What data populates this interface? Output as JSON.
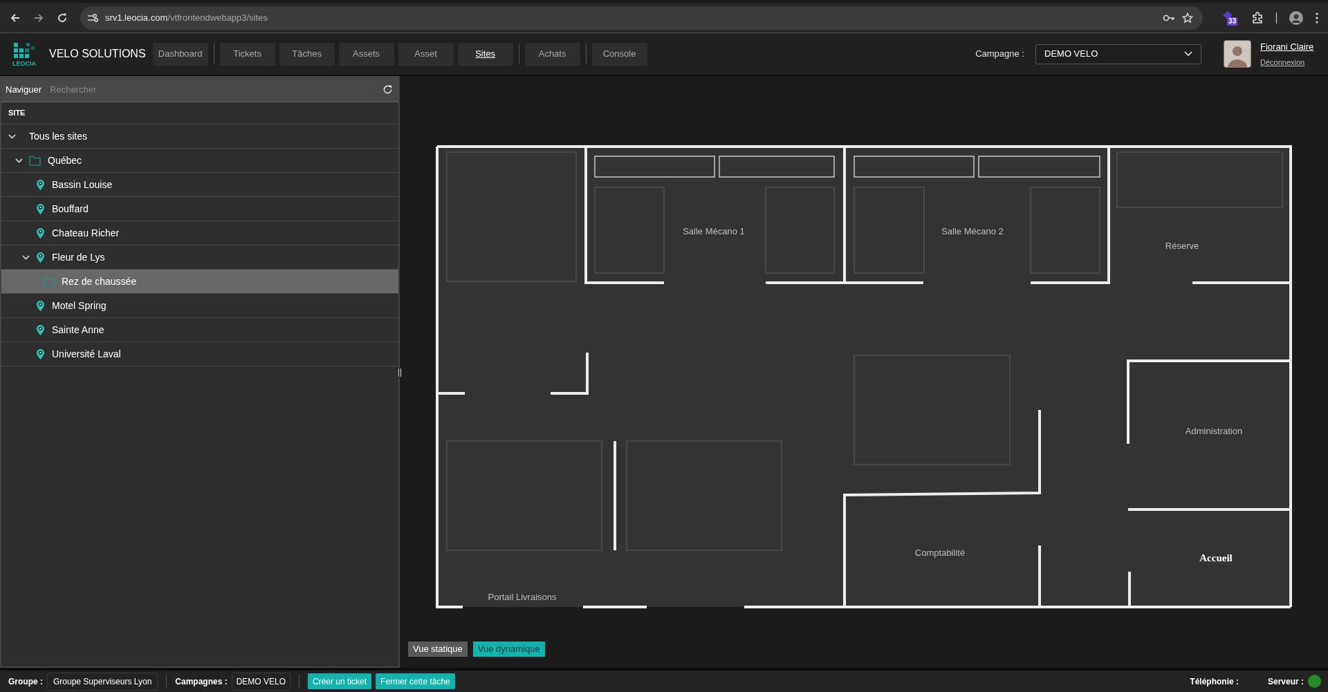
{
  "browser": {
    "url_host": "srv1.leocia.com",
    "url_path": "/vtfrontendwebapp3/sites",
    "extension_badge": "33"
  },
  "header": {
    "logo_text": "LEOCIA",
    "app_name": "VELO SOLUTIONS",
    "nav_groups": [
      [
        {
          "label": "Dashboard",
          "selected": false
        }
      ],
      [
        {
          "label": "Tickets",
          "selected": false
        },
        {
          "label": "Tâches",
          "selected": false
        },
        {
          "label": "Assets",
          "selected": false
        },
        {
          "label": "Asset",
          "selected": false
        },
        {
          "label": "Sites",
          "selected": true
        }
      ],
      [
        {
          "label": "Achats",
          "selected": false
        }
      ],
      [
        {
          "label": "Console",
          "selected": false
        }
      ]
    ],
    "campaign_label": "Campagne :",
    "campaign_value": "DEMO VELO",
    "user_name": "Fiorani Claire",
    "logout": "Déconnexion"
  },
  "navigator": {
    "title": "Naviguer",
    "search_placeholder": "Rechercher",
    "column_header": "SITE",
    "tree": [
      {
        "label": "Tous les sites",
        "kind": "root",
        "expanded": true,
        "selected": false,
        "children": [
          {
            "label": "Québec",
            "kind": "folder",
            "expanded": true,
            "selected": false,
            "children": [
              {
                "label": "Bassin Louise",
                "kind": "site",
                "selected": false
              },
              {
                "label": "Bouffard",
                "kind": "site",
                "selected": false
              },
              {
                "label": "Chateau Richer",
                "kind": "site",
                "selected": false
              },
              {
                "label": "Fleur de Lys",
                "kind": "site",
                "expanded": true,
                "selected": false,
                "children": [
                  {
                    "label": "Rez de chaussée",
                    "kind": "folder",
                    "selected": true
                  }
                ]
              },
              {
                "label": "Motel Spring",
                "kind": "site",
                "selected": false
              },
              {
                "label": "Sainte Anne",
                "kind": "site",
                "selected": false
              },
              {
                "label": "Université Laval",
                "kind": "site",
                "selected": false
              }
            ]
          }
        ]
      }
    ]
  },
  "floor_plan": {
    "rooms": [
      {
        "label": "Salle Mécano 1"
      },
      {
        "label": "Salle Mécano 2"
      },
      {
        "label": "Réserve"
      },
      {
        "label": "Administration"
      },
      {
        "label": "Comptabilité"
      },
      {
        "label": "Accueil"
      },
      {
        "label": "Portail Livraisons"
      }
    ],
    "view_buttons": [
      {
        "label": "Vue statique",
        "selected": false
      },
      {
        "label": "Vue dynamique",
        "selected": true
      }
    ]
  },
  "status_bar": {
    "group_label": "Groupe :",
    "group_value": "Groupe Superviseurs Lyon",
    "campaigns_label": "Campagnes :",
    "campaigns_value": "DEMO VELO",
    "actions": [
      "Créer un ticket",
      "Fermer cette tâche"
    ],
    "telephony_label": "Téléphonie :",
    "server_label": "Serveur :",
    "server_status": {
      "color": "#228b22"
    }
  }
}
